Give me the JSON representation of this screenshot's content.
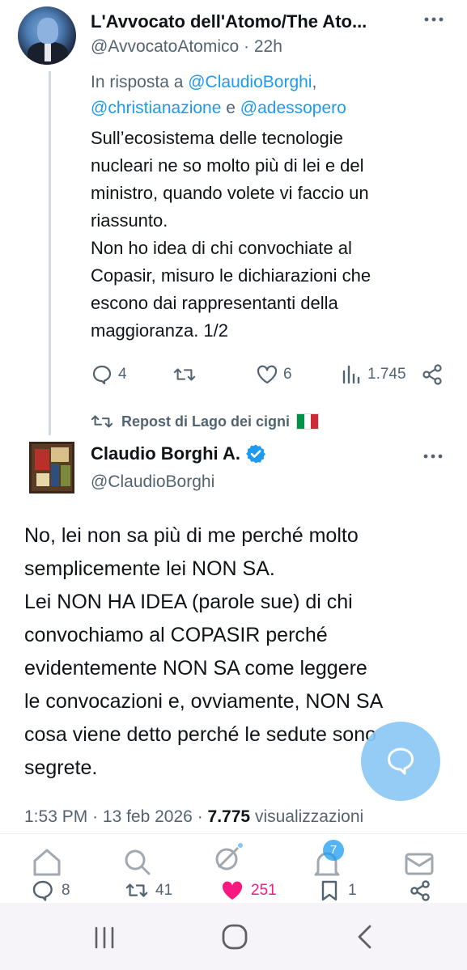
{
  "original_tweet": {
    "display_name": "L'Avvocato dell'Atomo/The Ato...",
    "handle": "@AvvocatoAtomico",
    "time_ago": "22h",
    "reply_prefix": "In risposta a ",
    "reply_mention_1": "@ClaudioBorghi",
    "reply_mention_2": "@christianazione",
    "reply_and": " e ",
    "reply_mention_3": "@adessopero",
    "text": "Sull’ecosistema delle tecnologie\nnucleari ne so molto più di lei e del\nministro, quando volete vi faccio un\nriassunto.\nNon ho idea di chi convochiate al\nCopasir, misuro le dichiarazioni che\nescono dai rappresentanti della\nmaggioranza. 1/2",
    "replies": "4",
    "likes": "6",
    "views": "1.745"
  },
  "repost_label": "Repost di Lago dei cigni",
  "flag_colors": [
    "#009246",
    "#ffffff",
    "#ce2b37"
  ],
  "main_tweet": {
    "display_name": "Claudio Borghi A.",
    "handle": "@ClaudioBorghi",
    "text": "No, lei non sa più di me perché molto\nsemplicemente lei NON SA.\nLei NON HA IDEA (parole sue) di chi\nconvochiamo al COPASIR perché\nevidentemente NON SA come leggere\nle convocazioni e, ovviamente, NON SA\ncosa viene detto perché le sedute sono\nsegrete.",
    "time": "1:53 PM",
    "dot": "·",
    "date": "13 feb 2026",
    "views_count": "7.775",
    "views_label": "visualizzazioni",
    "replies": "8",
    "reposts": "41",
    "likes": "251",
    "bookmarks": "1"
  },
  "bottom_nav": {
    "notifications_badge": "7"
  },
  "colors": {
    "accent": "#1d9bf0",
    "like_pink": "#f91880",
    "muted": "#536471",
    "verified": "#1d9bf0"
  }
}
